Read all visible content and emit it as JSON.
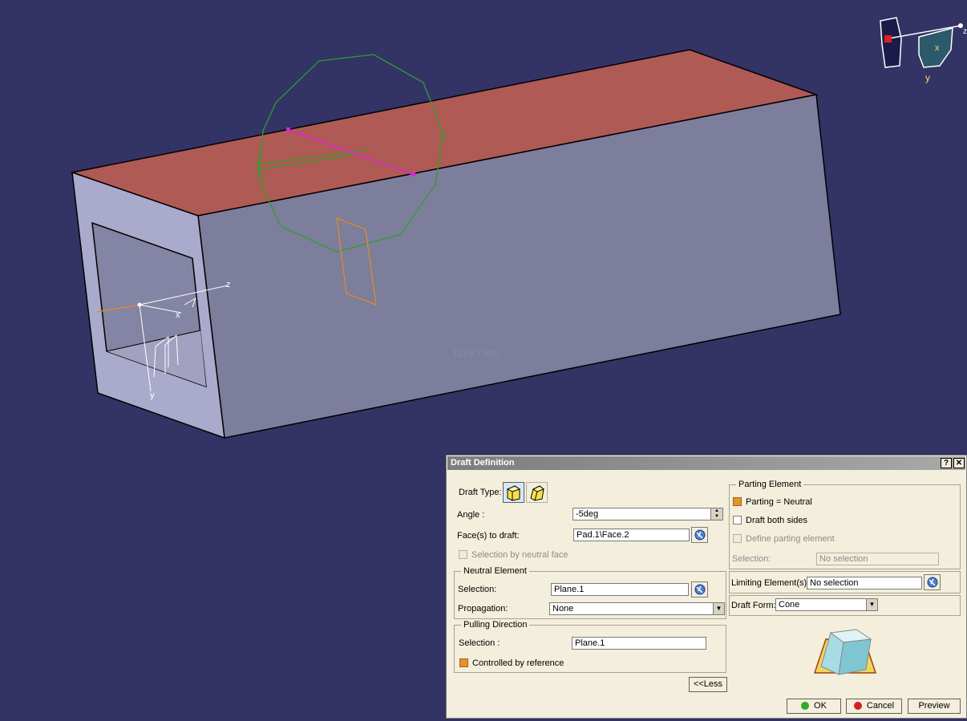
{
  "viewport": {
    "background": "#333366",
    "canvas_size_label": "1223 x 900",
    "axis_labels": {
      "x": "x",
      "y": "y",
      "z": "z"
    },
    "compass_labels": {
      "x": "x",
      "y": "y",
      "z": "z"
    }
  },
  "dialog": {
    "title": "Draft Definition",
    "help_label": "?",
    "close_label": "✕",
    "draft_type_label": "Draft Type:",
    "angle_label": "Angle :",
    "angle_value": "-5deg",
    "faces_label": "Face(s) to draft:",
    "faces_value": "Pad.1\\Face.2",
    "selection_by_neutral_face": "Selection by neutral face",
    "neutral_element": {
      "title": "Neutral Element",
      "selection_label": "Selection:",
      "selection_value": "Plane.1",
      "propagation_label": "Propagation:",
      "propagation_value": "None"
    },
    "pulling_direction": {
      "title": "Pulling Direction",
      "selection_label": "Selection :",
      "selection_value": "Plane.1",
      "controlled_by_reference": "Controlled by reference"
    },
    "parting_element": {
      "title": "Parting Element",
      "parting_equals_neutral": "Parting = Neutral",
      "draft_both_sides": "Draft both sides",
      "define_parting_element": "Define parting element",
      "selection_label": "Selection:",
      "selection_value": "No selection"
    },
    "limiting_label": "Limiting Element(s):",
    "limiting_value": "No selection",
    "draft_form_label": "Draft Form:",
    "draft_form_value": "Cone",
    "less_button": "<<Less",
    "ok_button": "OK",
    "cancel_button": "Cancel",
    "preview_button": "Preview",
    "colors": {
      "checked": "#e0952d",
      "ok_dot": "#2eaa2e",
      "cancel_dot": "#d22020"
    }
  }
}
